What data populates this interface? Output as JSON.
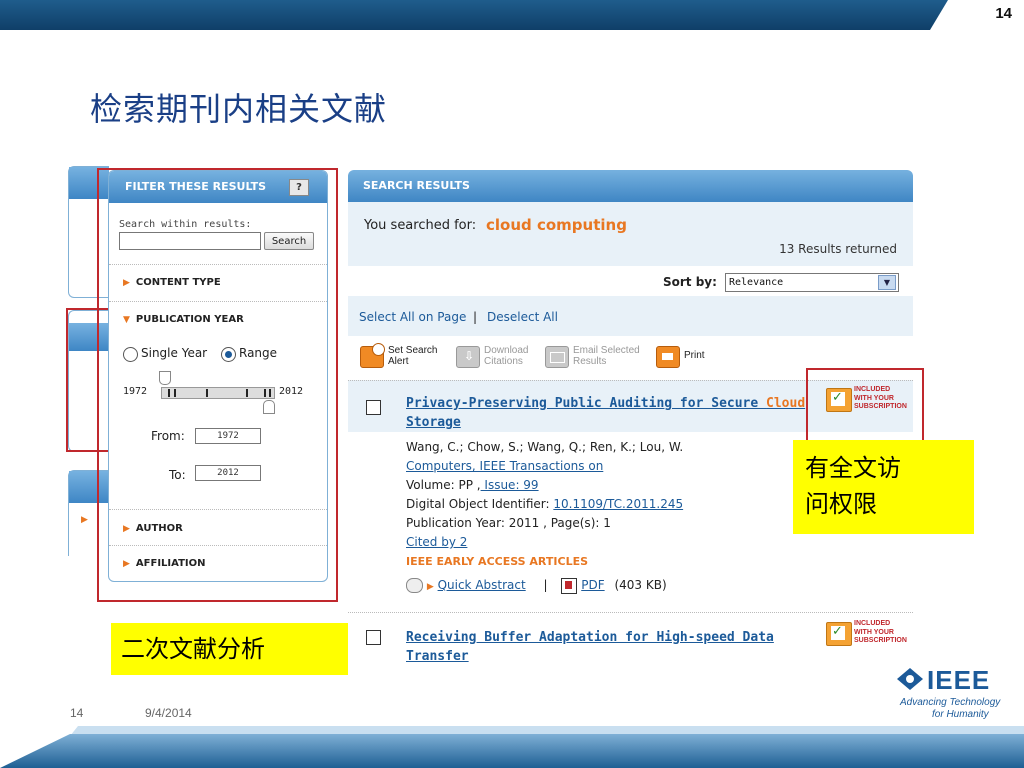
{
  "slide": {
    "number": "14",
    "title": "检索期刊内相关文献",
    "footer_page": "14",
    "footer_date": "9/4/2014",
    "logo_text": "IEEE",
    "logo_tagline_1": "Advancing Technology",
    "logo_tagline_2": "for Humanity"
  },
  "filter": {
    "title": "FILTER THESE RESULTS",
    "help": "?",
    "search_within_label": "Search within results:",
    "search_button": "Search",
    "content_type": "CONTENT TYPE",
    "publication_year": "PUBLICATION YEAR",
    "single_year": "Single Year",
    "range": "Range",
    "selected_mode": "Range",
    "year_min": "1972",
    "year_max": "2012",
    "from_label": "From:",
    "from_value": "1972",
    "to_label": "To:",
    "to_value": "2012",
    "author": "AUTHOR",
    "affiliation": "AFFILIATION"
  },
  "results": {
    "title": "SEARCH RESULTS",
    "searched_for_label": "You searched for:",
    "query": "cloud computing",
    "count": "13 Results returned",
    "sort_label": "Sort by:",
    "sort_value": "Relevance",
    "select_all": "Select All on Page",
    "deselect_all": "Deselect All",
    "toolbar": {
      "alert_1": "Set Search",
      "alert_2": "Alert",
      "download_1": "Download",
      "download_2": "Citations",
      "email_1": "Email Selected",
      "email_2": "Results",
      "print": "Print"
    },
    "badge": [
      "INCLUDED",
      "WITH YOUR",
      "SUBSCRIPTION"
    ],
    "items": [
      {
        "title_1": "Privacy-Preserving Public Auditing for Secure ",
        "title_hl": "Cloud",
        "title_2": "Storage",
        "authors": "Wang, C.; Chow, S.; Wang, Q.; Ren, K.; Lou, W.",
        "journal": "Computers, IEEE Transactions on",
        "volume_label": "Volume: PP ,",
        "issue": " Issue: 99",
        "doi_label": "Digital Object Identifier:",
        "doi": "10.1109/TC.2011.245",
        "pub_year": "Publication Year: 2011 , Page(s): 1",
        "cited": "Cited by 2",
        "early_access": "IEEE EARLY ACCESS ARTICLES",
        "quick_abstract": "Quick Abstract",
        "pdf": "PDF",
        "pdf_size": "(403  KB)"
      },
      {
        "title_1": "Receiving Buffer Adaptation for High-speed Data",
        "title_2": "Transfer"
      }
    ]
  },
  "annotations": {
    "fulltext_1": "有全文访",
    "fulltext_2": "问权限",
    "secondary": "二次文献分析"
  },
  "colors": {
    "accent_orange": "#e87722",
    "link_blue": "#1c5a99",
    "annotation_red": "#c0282d",
    "note_yellow": "#ffff00",
    "title_blue": "#1a3f86"
  }
}
